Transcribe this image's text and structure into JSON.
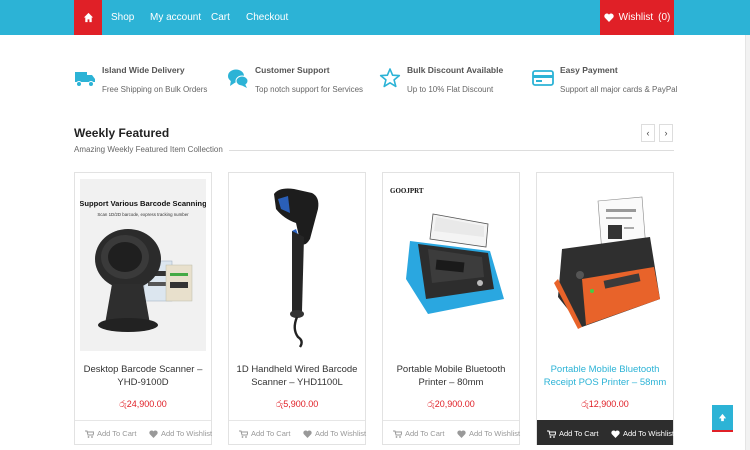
{
  "nav": {
    "home_icon": "home-icon",
    "items": [
      "Shop",
      "My account",
      "Cart",
      "Checkout"
    ],
    "wishlist_label": "Wishlist",
    "wishlist_count": "(0)"
  },
  "features": [
    {
      "icon": "truck-icon",
      "title": "Island Wide Delivery",
      "subtitle": "Free Shipping on Bulk Orders"
    },
    {
      "icon": "chat-icon",
      "title": "Customer Support",
      "subtitle": "Top notch support for Services"
    },
    {
      "icon": "star-icon",
      "title": "Bulk Discount Available",
      "subtitle": "Up to 10% Flat Discount"
    },
    {
      "icon": "credit-card-icon",
      "title": "Easy Payment",
      "subtitle": "Support all major cards & PayPal"
    }
  ],
  "section": {
    "title": "Weekly Featured",
    "subtitle": "Amazing Weekly Featured Item Collection",
    "prev": "‹",
    "next": "›"
  },
  "products": [
    {
      "name": "Desktop Barcode Scanner – YHD-9100D",
      "price": "රු24,900.00",
      "img_heading": "Support Various Barcode Scanning",
      "img_subheading": "Scan 1D/2D barcode, express tracking number",
      "add_to_cart": "Add To Cart",
      "add_to_wishlist": "Add To Wishlist"
    },
    {
      "name": "1D Handheld Wired Barcode Scanner – YHD1100L",
      "price": "රු5,900.00",
      "add_to_cart": "Add To Cart",
      "add_to_wishlist": "Add To Wishlist"
    },
    {
      "name": "Portable Mobile Bluetooth Printer – 80mm",
      "price": "රු20,900.00",
      "img_brand": "GOOJPRT",
      "add_to_cart": "Add To Cart",
      "add_to_wishlist": "Add To Wishlist"
    },
    {
      "name": "Portable Mobile Bluetooth Receipt POS Printer – 58mm",
      "price": "රු12,900.00",
      "add_to_cart": "Add To Cart",
      "add_to_wishlist": "Add To Wishlist"
    }
  ],
  "colors": {
    "accent": "#2cb3d6",
    "brand_red": "#e02027",
    "dark": "#2d2d2d"
  }
}
